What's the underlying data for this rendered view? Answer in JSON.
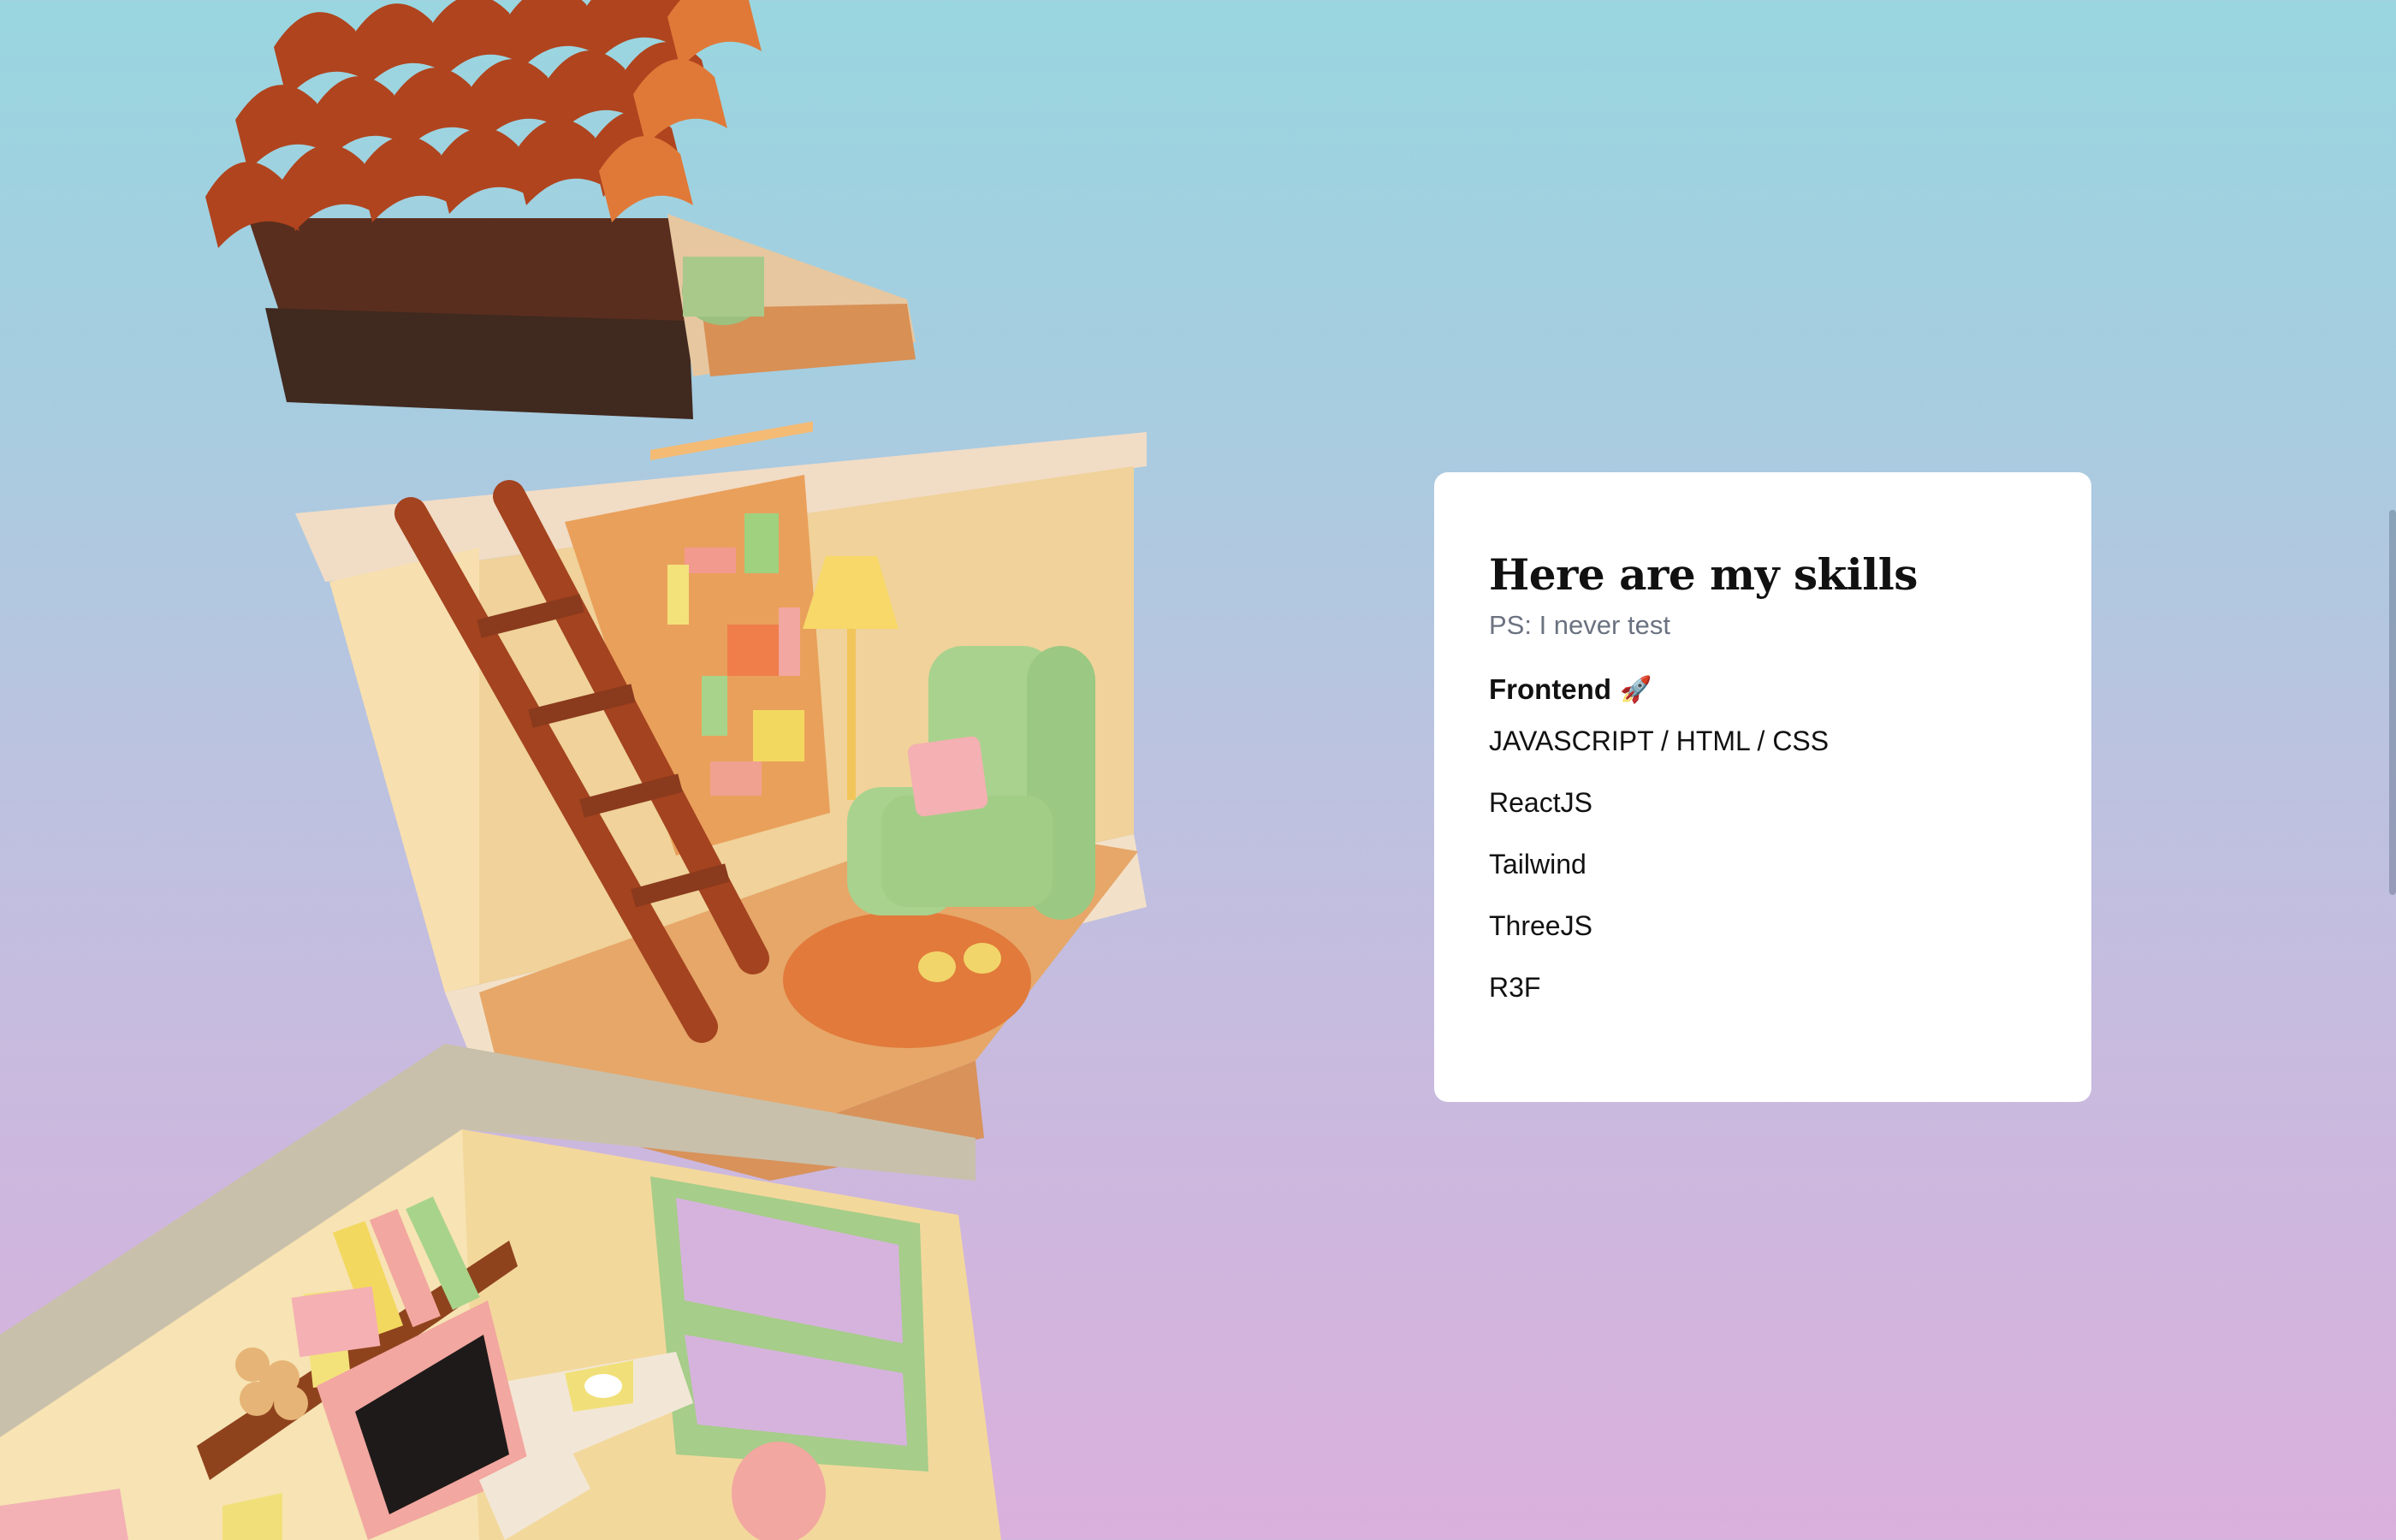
{
  "skills_card": {
    "title": "Here are my skills",
    "subtitle": "PS: I never test",
    "group": {
      "title": "Frontend",
      "icon": "rocket-icon",
      "icon_glyph": "🚀",
      "items": [
        "JAVASCRIPT / HTML / CSS",
        "ReactJS",
        "Tailwind",
        "ThreeJS",
        "R3F"
      ]
    }
  },
  "colors": {
    "background_top": "#99d6e0",
    "background_bottom": "#dab0dc",
    "card": "#ffffff",
    "subtitle": "#6b7280"
  }
}
